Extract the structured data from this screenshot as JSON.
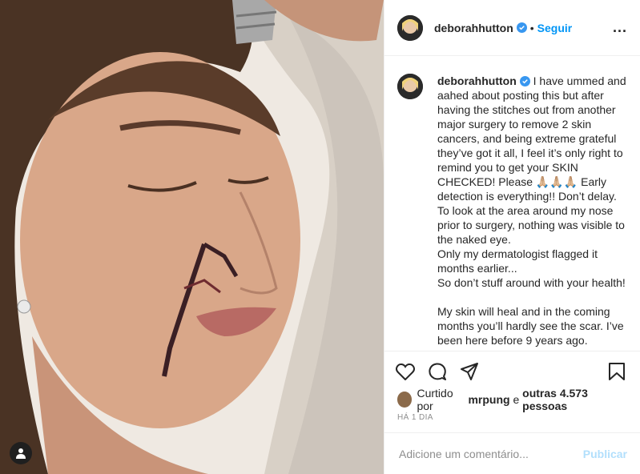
{
  "post": {
    "username": "deborahhutton",
    "follow_label": "Seguir",
    "dot": "•",
    "more": "...",
    "caption": " I have ummed and aahed about posting this but after having the stitches out from another major surgery to remove 2 skin cancers, and being extreme grateful they’ve got it all, I feel it’s only right to remind you to get your SKIN CHECKED! Please 🙏🏼🙏🏼🙏🏼 Early detection is everything!! Don’t delay.\nTo look at the area around my nose prior to surgery, nothing was visible to the naked eye.\nOnly my dermatologist flagged it months earlier...\nSo don’t stuff around with your health!\n\nMy skin will heal and in the coming months you’ll hardly see the scar. I’ve been here before 9 years ago.",
    "likes_prefix": "Curtido por ",
    "liked_by": "mrpung",
    "likes_middle": " e ",
    "others": "outras 4.573 pessoas",
    "time": "HÁ 1 DIA",
    "comment_placeholder": "Adicione um comentário...",
    "publish_label": "Publicar"
  },
  "colors": {
    "accent": "#0095f6",
    "publish_disabled": "#b2dffc",
    "verified": "#3897f0"
  },
  "icons": [
    "heart-icon",
    "comment-icon",
    "share-icon",
    "bookmark-icon",
    "verified-icon",
    "user-tag-icon"
  ]
}
